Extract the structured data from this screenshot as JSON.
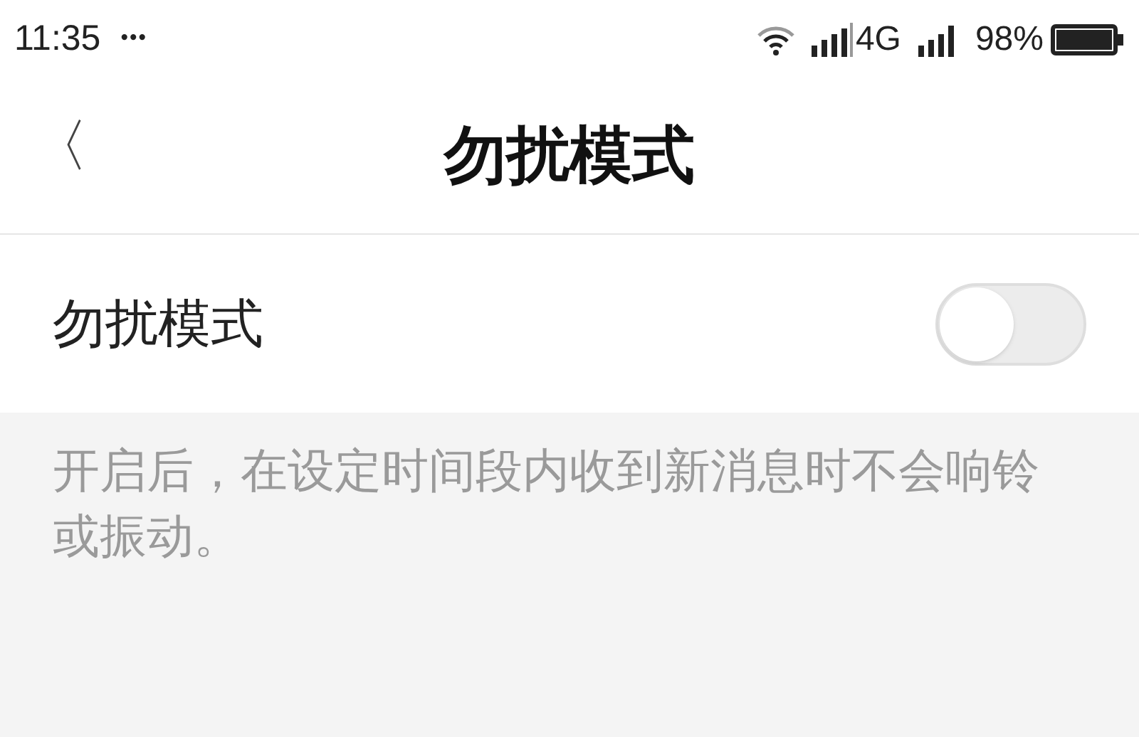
{
  "status_bar": {
    "time": "11:35",
    "dots": "•••",
    "network": "4G",
    "battery": "98%"
  },
  "header": {
    "back": "〈",
    "title": "勿扰模式"
  },
  "setting": {
    "label": "勿扰模式",
    "on": false
  },
  "description": "开启后，在设定时间段内收到新消息时不会响铃或振动。"
}
